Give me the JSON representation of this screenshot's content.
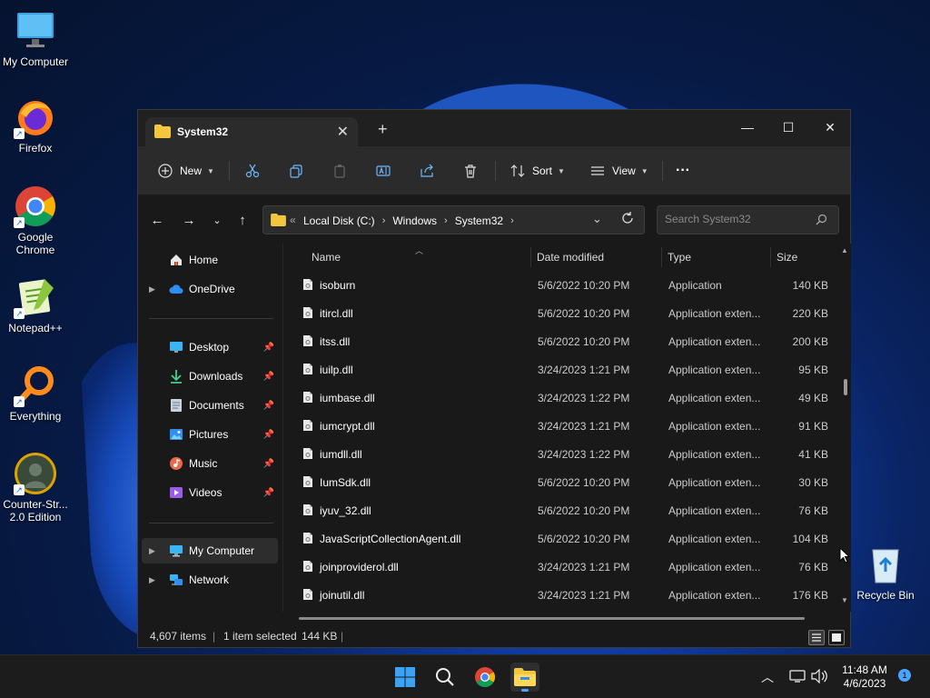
{
  "desktop": {
    "icons": [
      {
        "label": "My Computer",
        "icon": "monitor-icon"
      },
      {
        "label": "Firefox",
        "icon": "firefox-icon"
      },
      {
        "label": "Google Chrome",
        "icon": "chrome-icon"
      },
      {
        "label": "Notepad++",
        "icon": "notepadpp-icon"
      },
      {
        "label": "Everything",
        "icon": "search-magnifier-icon"
      },
      {
        "label": "Counter-Str... 2.0 Edition",
        "icon": "game-icon"
      },
      {
        "label": "Recycle Bin",
        "icon": "recycle-bin-icon"
      }
    ]
  },
  "window": {
    "tab_title": "System32",
    "new_tab": "+",
    "controls": {
      "minimize": "—",
      "maximize": "☐",
      "close": "✕"
    }
  },
  "toolbar": {
    "new_label": "New",
    "sort_label": "Sort",
    "view_label": "View",
    "more": "···"
  },
  "address": {
    "prefix": "«",
    "crumbs": [
      "Local Disk (C:)",
      "Windows",
      "System32"
    ],
    "search_placeholder": "Search System32"
  },
  "sidebar": {
    "items": [
      {
        "label": "Home",
        "icon": "home-icon"
      },
      {
        "label": "OneDrive",
        "icon": "cloud-icon"
      },
      {
        "label": "Desktop",
        "icon": "desktop-folder-icon"
      },
      {
        "label": "Downloads",
        "icon": "download-icon"
      },
      {
        "label": "Documents",
        "icon": "documents-icon"
      },
      {
        "label": "Pictures",
        "icon": "pictures-icon"
      },
      {
        "label": "Music",
        "icon": "music-icon"
      },
      {
        "label": "Videos",
        "icon": "videos-icon"
      },
      {
        "label": "My Computer",
        "icon": "computer-icon"
      },
      {
        "label": "Network",
        "icon": "network-icon"
      }
    ]
  },
  "columns": {
    "name": "Name",
    "date": "Date modified",
    "type": "Type",
    "size": "Size"
  },
  "files": [
    {
      "name": "isoburn",
      "date": "5/6/2022 10:20 PM",
      "type": "Application",
      "size": "140 KB"
    },
    {
      "name": "itircl.dll",
      "date": "5/6/2022 10:20 PM",
      "type": "Application exten...",
      "size": "220 KB"
    },
    {
      "name": "itss.dll",
      "date": "5/6/2022 10:20 PM",
      "type": "Application exten...",
      "size": "200 KB"
    },
    {
      "name": "iuilp.dll",
      "date": "3/24/2023 1:21 PM",
      "type": "Application exten...",
      "size": "95 KB"
    },
    {
      "name": "iumbase.dll",
      "date": "3/24/2023 1:22 PM",
      "type": "Application exten...",
      "size": "49 KB"
    },
    {
      "name": "iumcrypt.dll",
      "date": "3/24/2023 1:21 PM",
      "type": "Application exten...",
      "size": "91 KB"
    },
    {
      "name": "iumdll.dll",
      "date": "3/24/2023 1:22 PM",
      "type": "Application exten...",
      "size": "41 KB"
    },
    {
      "name": "IumSdk.dll",
      "date": "5/6/2022 10:20 PM",
      "type": "Application exten...",
      "size": "30 KB"
    },
    {
      "name": "iyuv_32.dll",
      "date": "5/6/2022 10:20 PM",
      "type": "Application exten...",
      "size": "76 KB"
    },
    {
      "name": "JavaScriptCollectionAgent.dll",
      "date": "5/6/2022 10:20 PM",
      "type": "Application exten...",
      "size": "104 KB"
    },
    {
      "name": "joinproviderol.dll",
      "date": "3/24/2023 1:21 PM",
      "type": "Application exten...",
      "size": "76 KB"
    },
    {
      "name": "joinutil.dll",
      "date": "3/24/2023 1:21 PM",
      "type": "Application exten...",
      "size": "176 KB"
    }
  ],
  "status": {
    "items": "4,607 items",
    "selected": "1 item selected",
    "selected_size": "144 KB"
  },
  "taskbar": {
    "time": "11:48 AM",
    "date": "4/6/2023",
    "notifications": "1"
  },
  "colors": {
    "accent": "#4aa3ff",
    "folder": "#f3c63f"
  }
}
